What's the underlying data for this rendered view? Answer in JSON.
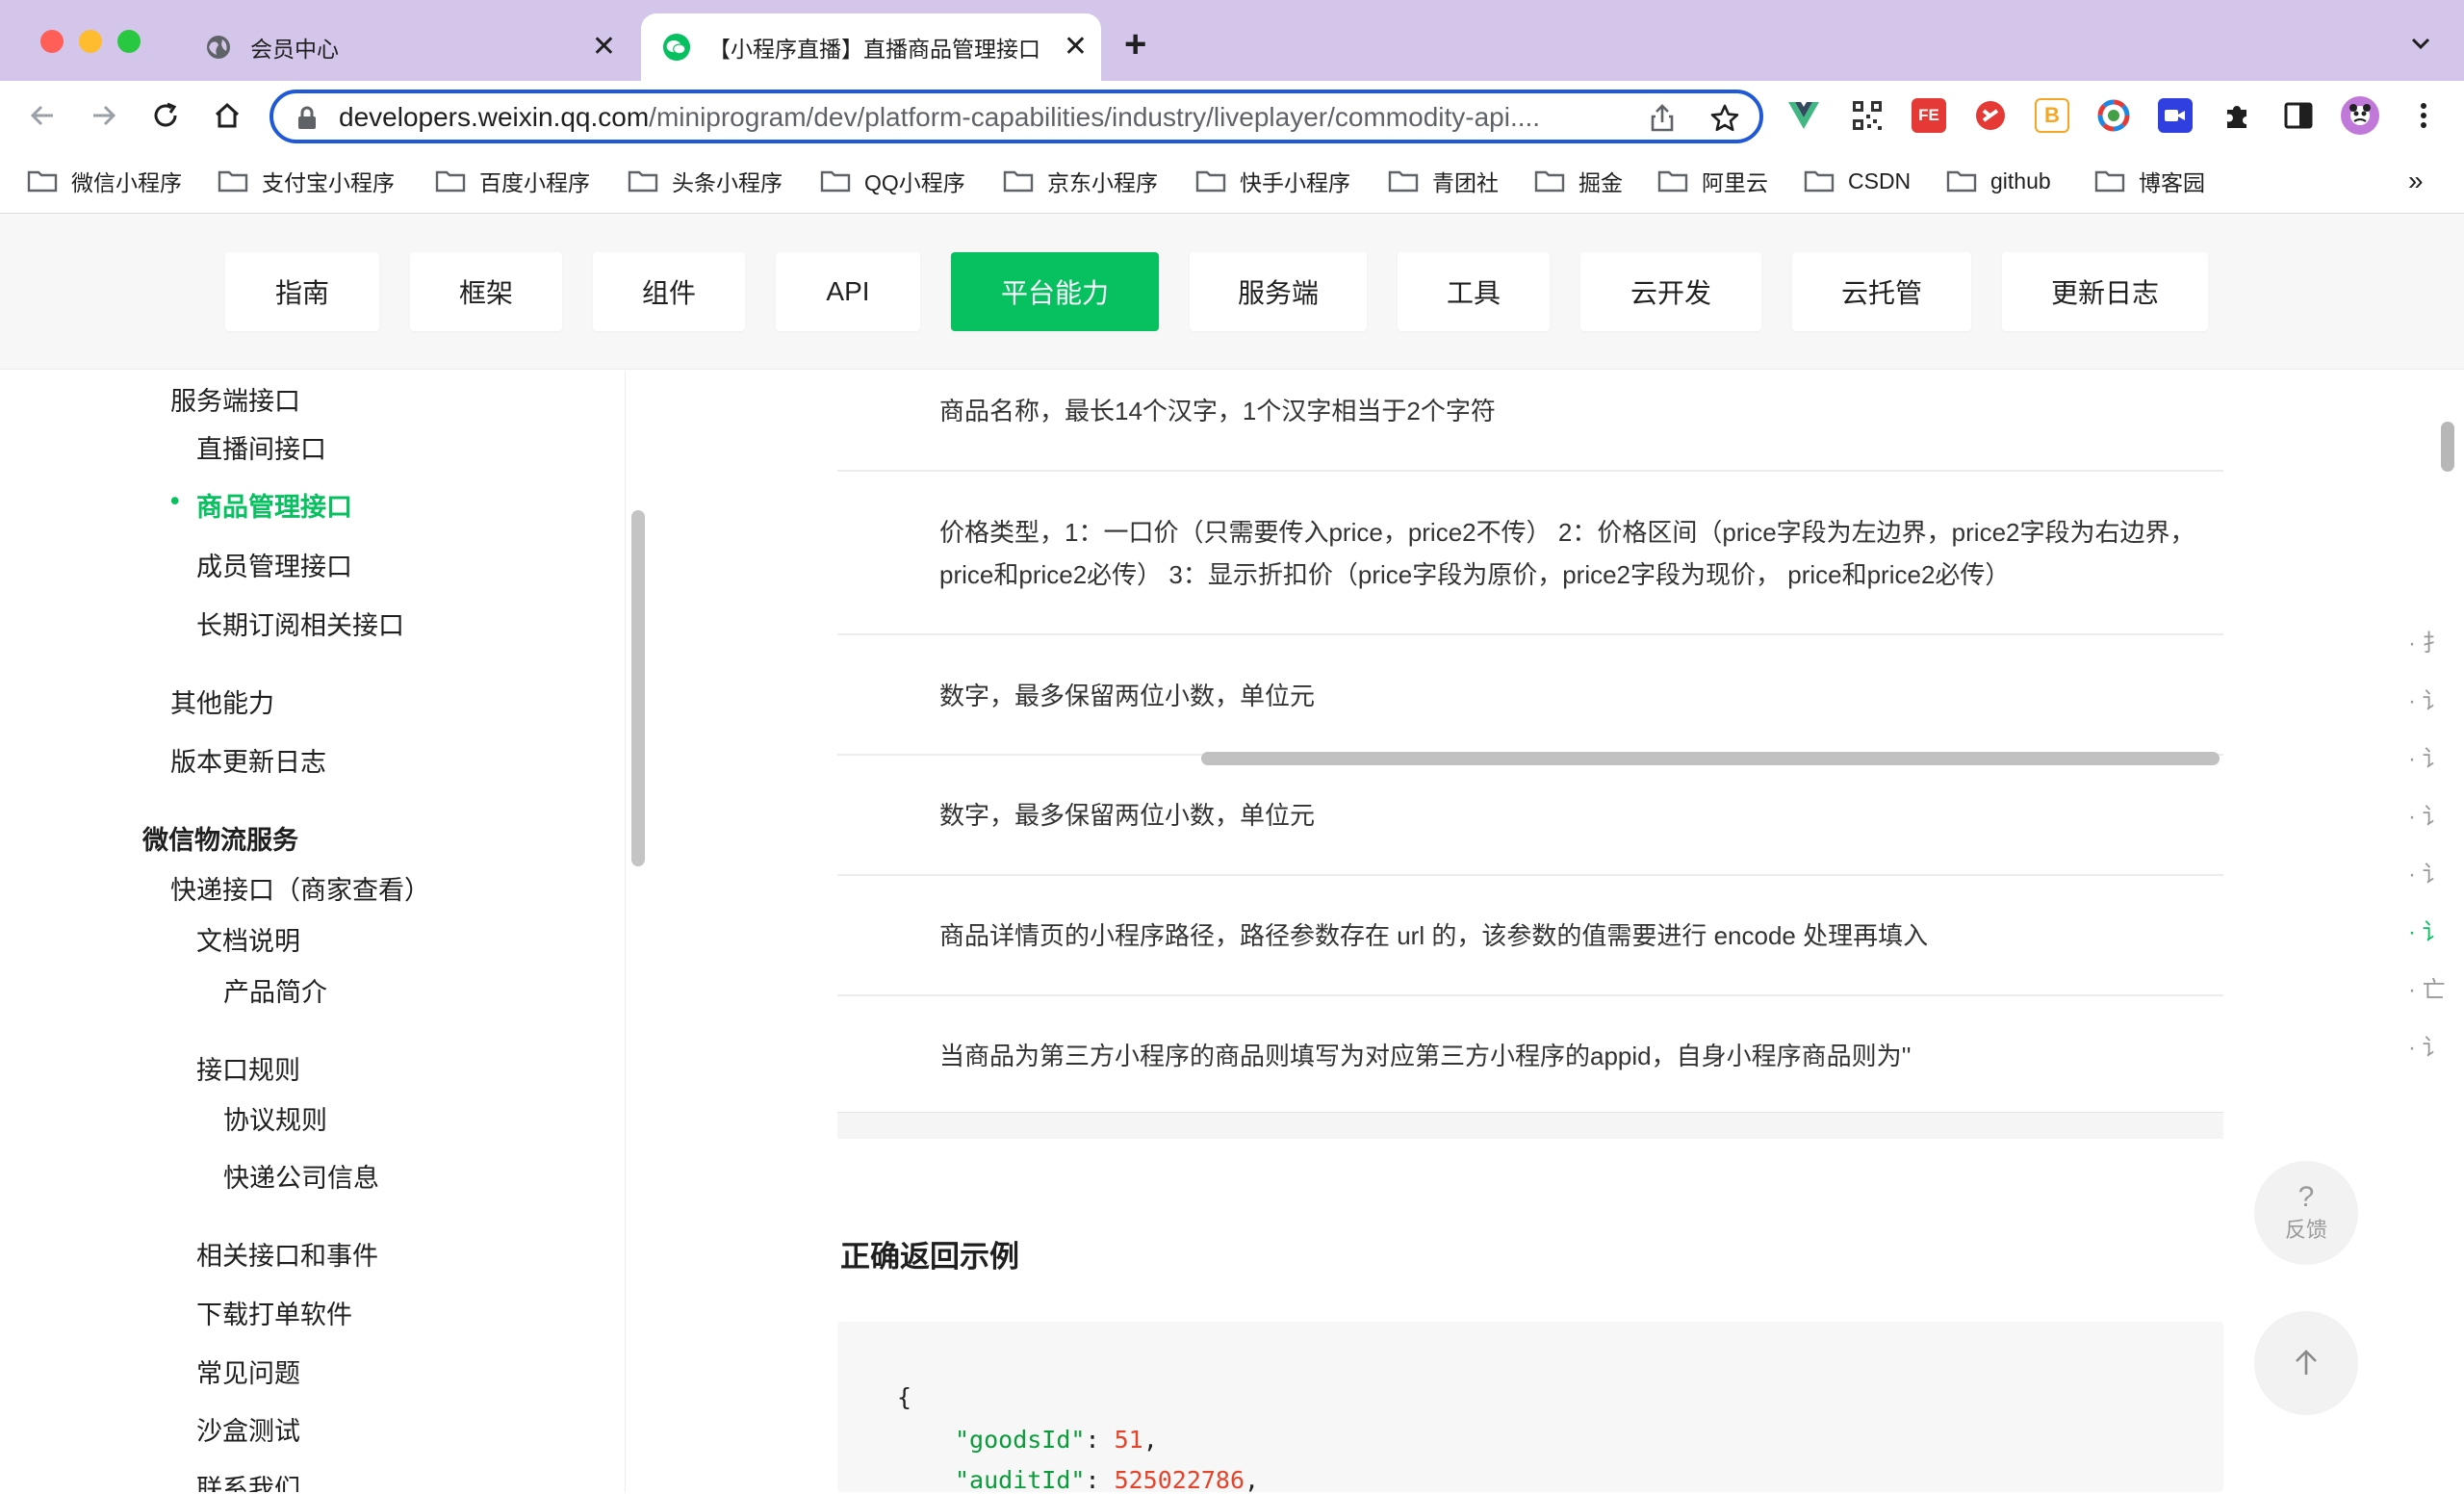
{
  "browser": {
    "tabs": [
      {
        "title": "会员中心",
        "active": false
      },
      {
        "title": "【小程序直播】直播商品管理接口",
        "active": true
      }
    ],
    "new_tab": "+",
    "tab_list": "⌄",
    "close_symbol": "✕",
    "url_host": "developers.weixin.qq.com",
    "url_path": "/miniprogram/dev/platform-capabilities/industry/liveplayer/commodity-api....",
    "bookmarks": [
      "微信小程序",
      "支付宝小程序",
      "百度小程序",
      "头条小程序",
      "QQ小程序",
      "京东小程序",
      "快手小程序",
      "青团社",
      "掘金",
      "阿里云",
      "CSDN",
      "github",
      "博客园"
    ],
    "bookmarks_more": "»",
    "colors": {
      "tabstrip": "#d4c6ea",
      "focus_ring": "#1f59d8"
    }
  },
  "site_nav": {
    "items": [
      "指南",
      "框架",
      "组件",
      "API",
      "平台能力",
      "服务端",
      "工具",
      "云开发",
      "云托管",
      "更新日志"
    ],
    "active_index": 4,
    "accent": "#07c160"
  },
  "sidebar": {
    "items": [
      {
        "label": "服务端接口"
      },
      {
        "label": "直播间接口"
      },
      {
        "label": "商品管理接口",
        "active": true
      },
      {
        "label": "成员管理接口"
      },
      {
        "label": "长期订阅相关接口"
      },
      {
        "label": "其他能力"
      },
      {
        "label": "版本更新日志"
      },
      {
        "label": "微信物流服务",
        "heading": true
      },
      {
        "label": "快递接口（商家查看）"
      },
      {
        "label": "文档说明"
      },
      {
        "label": "产品简介"
      },
      {
        "label": "接口规则"
      },
      {
        "label": "协议规则"
      },
      {
        "label": "快递公司信息"
      },
      {
        "label": "相关接口和事件"
      },
      {
        "label": "下载打单软件"
      },
      {
        "label": "常见问题"
      },
      {
        "label": "沙盒测试"
      },
      {
        "label": "联系我们"
      }
    ],
    "bullet": "•"
  },
  "main": {
    "rows": [
      "商品名称，最长14个汉字，1个汉字相当于2个字符",
      "价格类型，1：一口价（只需要传入price，price2不传） 2：价格区间（price字段为左边界，price2字段为右边界，price和price2必传） 3：显示折扣价（price字段为原价，price2字段为现价， price和price2必传）",
      "数字，最多保留两位小数，单位元",
      "数字，最多保留两位小数，单位元",
      "商品详情页的小程序路径，路径参数存在 url 的，该参数的值需要进行 encode 处理再填入",
      "当商品为第三方小程序的商品则填写为对应第三方小程序的appid，自身小程序商品则为''"
    ],
    "section_title": "正确返回示例",
    "code": {
      "open": "{",
      "goods_key": "\"goodsId\"",
      "goods_val": "51",
      "audit_key": "\"auditId\"",
      "audit_val": "525022786"
    }
  },
  "toc": {
    "items": [
      "· 扌",
      "· 讠",
      "· 讠",
      "· 讠",
      "· 讠",
      "· 讠",
      "· 亡",
      "· 讠"
    ],
    "active_index": 5
  },
  "floating": {
    "feedback_symbol": "?",
    "feedback_label": "反馈",
    "top_symbol": "↑"
  }
}
